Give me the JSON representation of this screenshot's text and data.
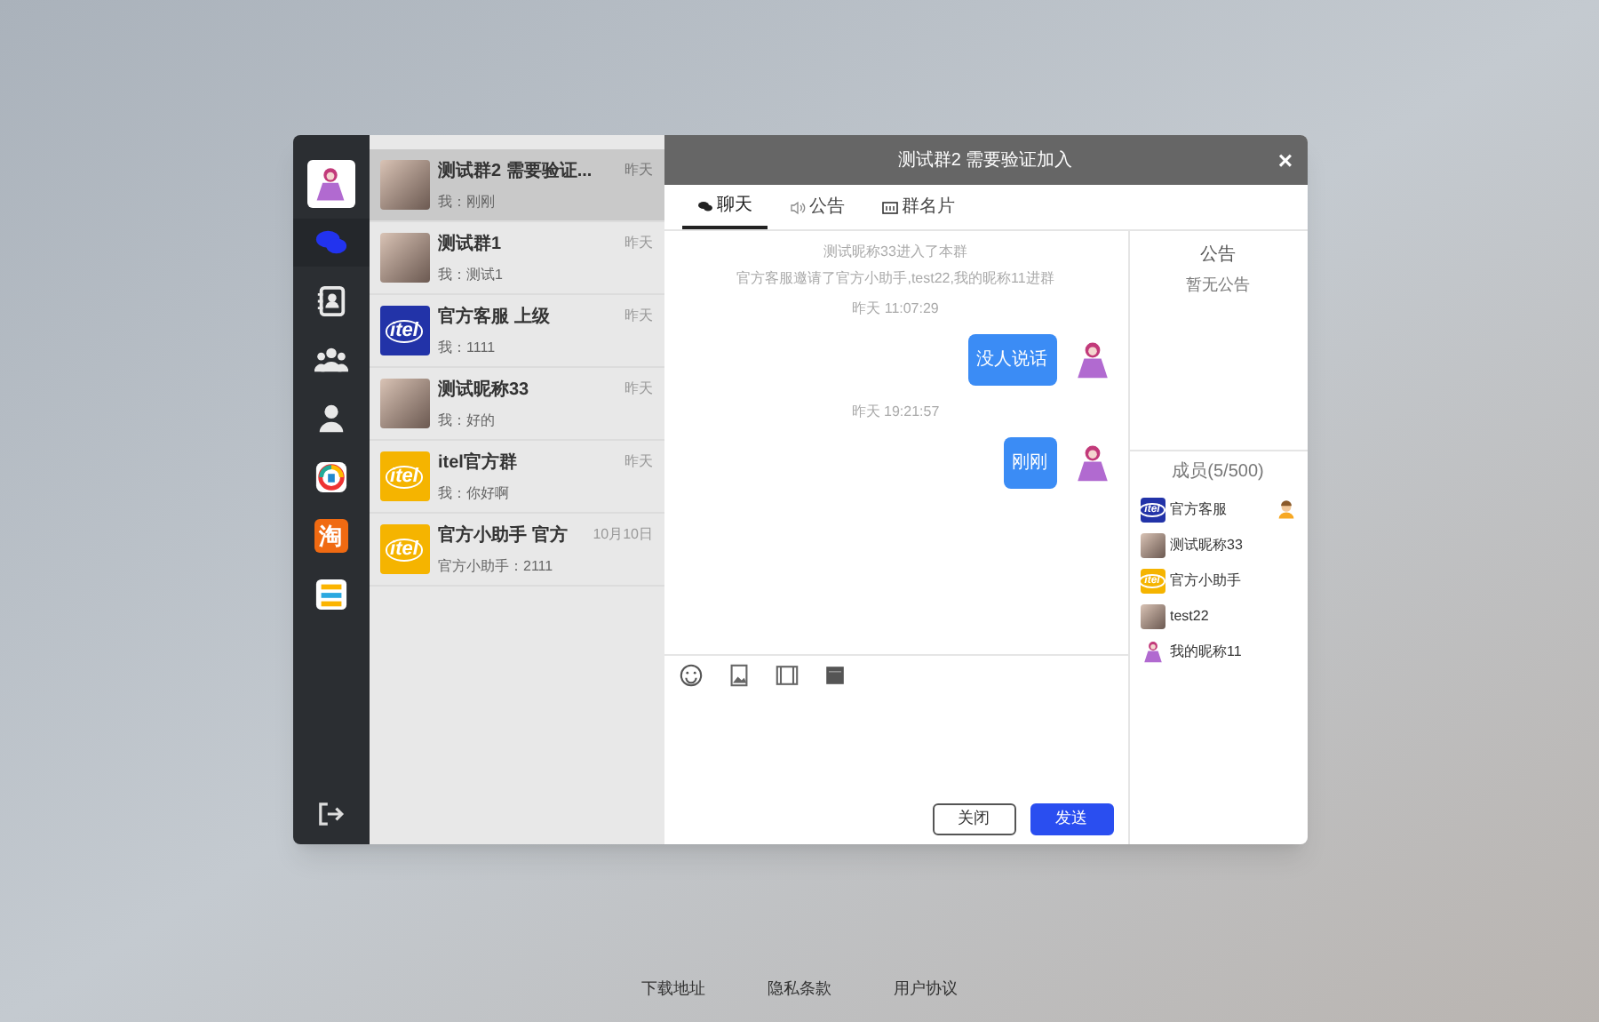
{
  "sidebar": {
    "items": [
      {
        "kind": "avatar",
        "selected": false
      },
      {
        "kind": "chat",
        "selected": true
      },
      {
        "kind": "contacts",
        "selected": false
      },
      {
        "kind": "group",
        "selected": false
      },
      {
        "kind": "person",
        "selected": false
      },
      {
        "kind": "app-round",
        "selected": false
      },
      {
        "kind": "app-text",
        "label": "淘",
        "selected": false
      },
      {
        "kind": "app-stack",
        "selected": false
      }
    ]
  },
  "conversations": [
    {
      "name": "测试群2 需要验证...",
      "preview": "我：刚刚",
      "time": "昨天",
      "kind": "photo",
      "selected": true
    },
    {
      "name": "测试群1",
      "preview": "我：测试1",
      "time": "昨天",
      "kind": "photo",
      "selected": false
    },
    {
      "name": "官方客服 上级",
      "preview": "我：1111",
      "time": "昨天",
      "kind": "blue",
      "logo": "itel",
      "selected": false
    },
    {
      "name": "测试昵称33",
      "preview": "我：好的",
      "time": "昨天",
      "kind": "photo",
      "selected": false
    },
    {
      "name": "itel官方群",
      "preview": "我：你好啊",
      "time": "昨天",
      "kind": "yellow",
      "logo": "itel",
      "selected": false
    },
    {
      "name": "官方小助手 官方",
      "preview": "官方小助手：2111",
      "time": "10月10日",
      "kind": "yellow",
      "logo": "itel",
      "selected": false
    }
  ],
  "chat": {
    "title": "测试群2 需要验证加入",
    "close": "×",
    "tabs": [
      {
        "label": "聊天",
        "kind": "chat",
        "selected": true
      },
      {
        "label": "公告",
        "kind": "speaker",
        "selected": false
      },
      {
        "label": "群名片",
        "kind": "card",
        "selected": false
      }
    ],
    "messages": [
      {
        "kind": "system",
        "text": "测试昵称33进入了本群"
      },
      {
        "kind": "system",
        "text": "官方客服邀请了官方小助手,test22,我的昵称11进群"
      },
      {
        "kind": "time",
        "text": "昨天 11:07:29"
      },
      {
        "kind": "mine",
        "text": "没人说话"
      },
      {
        "kind": "time",
        "text": "昨天 19:21:57"
      },
      {
        "kind": "mine",
        "text": "刚刚"
      }
    ],
    "toolbar": [
      {
        "kind": "emoji"
      },
      {
        "kind": "image"
      },
      {
        "kind": "video"
      },
      {
        "kind": "file"
      }
    ],
    "buttons": [
      {
        "label": "关闭",
        "kind": "secondary"
      },
      {
        "label": "发送",
        "kind": "primary"
      }
    ]
  },
  "side_panel": {
    "notice_title": "公告",
    "notice": "暂无公告",
    "members_title": "成员(5/500)",
    "members": [
      {
        "name": "官方客服",
        "kind": "blue",
        "logo": "itel",
        "owner": true
      },
      {
        "name": "测试昵称33",
        "kind": "photo",
        "owner": false
      },
      {
        "name": "官方小助手",
        "kind": "yellow",
        "logo": "itel",
        "owner": false
      },
      {
        "name": "test22",
        "kind": "photo",
        "owner": false
      },
      {
        "name": "我的昵称11",
        "kind": "figure",
        "owner": false
      }
    ]
  },
  "footer_links": [
    "下载地址",
    "隐私条款",
    "用户协议"
  ]
}
